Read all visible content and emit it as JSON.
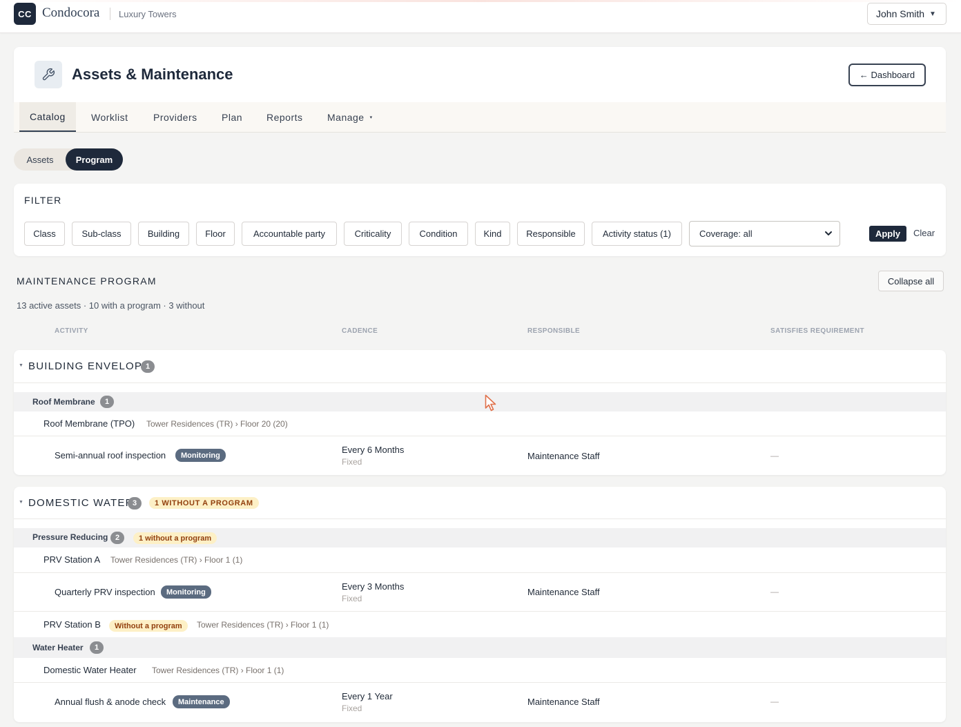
{
  "app": {
    "logo_initials": "CC",
    "brand": "Condocora",
    "property": "Luxury Towers",
    "user": "John Smith",
    "user_caret": "▼"
  },
  "header": {
    "icon": "wrench-icon",
    "title": "Assets & Maintenance",
    "dashboard_button": "← Dashboard"
  },
  "tabs": [
    {
      "label": "Catalog",
      "active": true
    },
    {
      "label": "Worklist"
    },
    {
      "label": "Providers"
    },
    {
      "label": "Plan"
    },
    {
      "label": "Reports"
    },
    {
      "label": "Manage",
      "caret": "▾"
    }
  ],
  "segment": {
    "options": [
      "Assets",
      "Program"
    ],
    "selected": "Program"
  },
  "filter": {
    "title": "FILTER",
    "chips": [
      "Class",
      "Sub-class",
      "Building",
      "Floor",
      "Accountable party",
      "Criticality",
      "Condition",
      "Kind",
      "Responsible",
      "Activity status (1)"
    ],
    "coverage_value": "Coverage: all",
    "apply": "Apply",
    "clear": "Clear"
  },
  "program": {
    "title": "MAINTENANCE PROGRAM",
    "collapse_all": "Collapse all",
    "summary": "13 active assets · 10 with a program · 3 without",
    "columns": [
      "ACTIVITY",
      "CADENCE",
      "RESPONSIBLE",
      "SATISFIES REQUIREMENT"
    ],
    "groups": [
      {
        "name": "BUILDING ENVELOPE",
        "count": "1",
        "subclasses": [
          {
            "name": "Roof Membrane",
            "count": "1",
            "assets": [
              {
                "name": "Roof Membrane (TPO)",
                "location": "Tower Residences (TR) › Floor 20 (20)",
                "activities": [
                  {
                    "name": "Semi-annual roof inspection",
                    "kind": "Monitoring",
                    "cadence": "Every 6 Months",
                    "cadence_type": "Fixed",
                    "responsible": "Maintenance Staff",
                    "satisfies": "—"
                  }
                ]
              }
            ]
          }
        ]
      },
      {
        "name": "DOMESTIC WATER",
        "count": "3",
        "warning": "1 WITHOUT A PROGRAM",
        "subclasses": [
          {
            "name": "Pressure Reducing",
            "count": "2",
            "warning": "1 without a program",
            "assets": [
              {
                "name": "PRV Station A",
                "location": "Tower Residences (TR) › Floor 1 (1)",
                "activities": [
                  {
                    "name": "Quarterly PRV inspection",
                    "kind": "Monitoring",
                    "cadence": "Every 3 Months",
                    "cadence_type": "Fixed",
                    "responsible": "Maintenance Staff",
                    "satisfies": "—"
                  }
                ]
              },
              {
                "name": "PRV Station B",
                "badge": "Without a program",
                "location": "Tower Residences (TR) › Floor 1 (1)",
                "activities": []
              }
            ]
          },
          {
            "name": "Water Heater",
            "count": "1",
            "assets": [
              {
                "name": "Domestic Water Heater",
                "location": "Tower Residences (TR) › Floor 1 (1)",
                "activities": [
                  {
                    "name": "Annual flush & anode check",
                    "kind": "Maintenance",
                    "cadence": "Every 1 Year",
                    "cadence_type": "Fixed",
                    "responsible": "Maintenance Staff",
                    "satisfies": "—"
                  }
                ]
              }
            ]
          }
        ]
      }
    ]
  },
  "colors": {
    "navy": "#1e293b",
    "badge_slate": "#5b6b80",
    "warning_bg": "#fdf0c6",
    "warning_text": "#92400e",
    "page_bg": "#f4f4f3"
  }
}
